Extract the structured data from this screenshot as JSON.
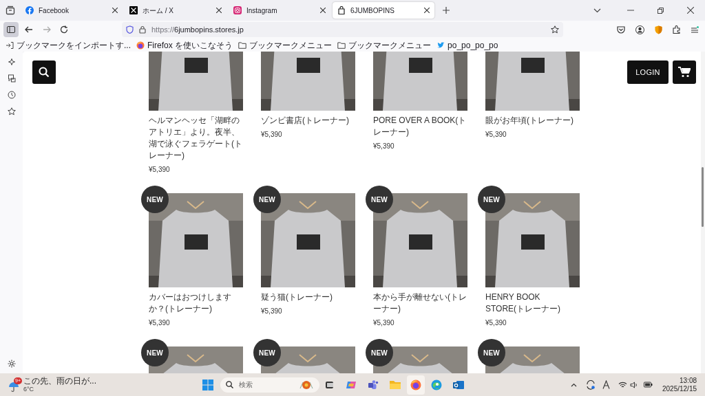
{
  "tabs": [
    {
      "title": "Facebook",
      "selected": false
    },
    {
      "title": "ホーム / X",
      "selected": false
    },
    {
      "title": "Instagram",
      "selected": false
    },
    {
      "title": "6JUMBOPINS",
      "selected": true
    }
  ],
  "address_bar": {
    "scheme": "https://",
    "host": "6jumbopins.stores.jp"
  },
  "bookmarks": [
    {
      "label": "ブックマークをインポートす..."
    },
    {
      "label": "Firefox を使いこなそう"
    },
    {
      "label": "ブックマークメニュー"
    },
    {
      "label": "ブックマークメニュー"
    },
    {
      "label": "po_po_po_po"
    }
  ],
  "store_header": {
    "login": "LOGIN"
  },
  "products": [
    {
      "title": "ヘルマンヘッセ「湖畔のアトリエ」より。夜半、湖で泳ぐフェラゲート(トレーナー)",
      "price": "¥5,390"
    },
    {
      "title": "ゾンビ書店(トレーナー)",
      "price": "¥5,390"
    },
    {
      "title": "PORE OVER A BOOK(トレーナー)",
      "price": "¥5,390"
    },
    {
      "title": "眼がお年頃(トレーナー)",
      "price": "¥5,390"
    },
    {
      "badge": "NEW",
      "title": "カバーはおつけしますか？(トレーナー)",
      "price": "¥5,390"
    },
    {
      "badge": "NEW",
      "title": "疑う猫(トレーナー)",
      "price": "¥5,390"
    },
    {
      "badge": "NEW",
      "title": "本から手が離せない(トレーナー)",
      "price": "¥5,390"
    },
    {
      "badge": "NEW",
      "title": "HENRY BOOK STORE(トレーナー)",
      "price": "¥5,390"
    },
    {
      "badge": "NEW"
    },
    {
      "badge": "NEW"
    },
    {
      "badge": "NEW"
    },
    {
      "badge": "NEW"
    }
  ],
  "taskbar": {
    "weather_badge": "9+",
    "weather_text": "この先、雨の日が...",
    "temperature": "6°C",
    "search_placeholder": "検索",
    "time": "13:08",
    "date": "2025/12/15"
  }
}
